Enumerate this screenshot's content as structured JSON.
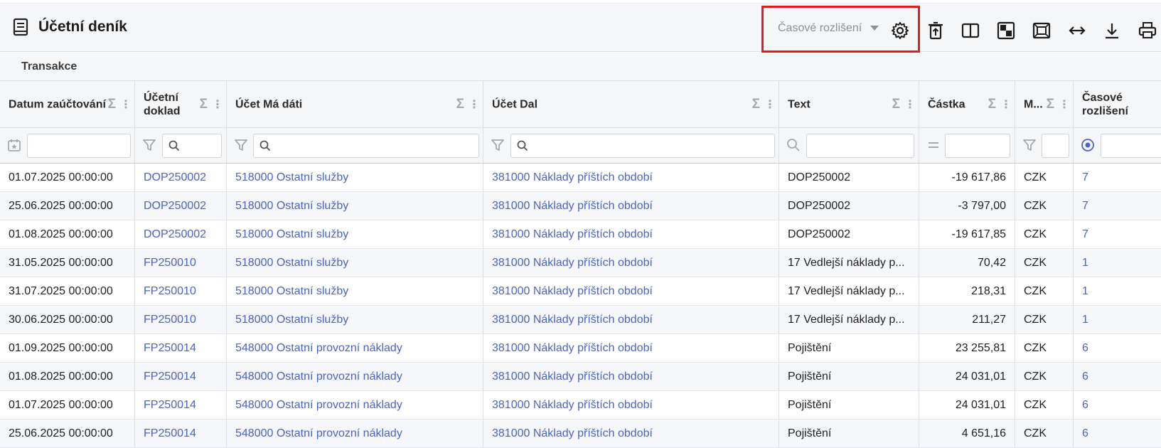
{
  "header": {
    "title": "Účetní deník",
    "dropdown_label": "Časové rozlišení"
  },
  "tabs": [
    {
      "label": "Transakce"
    }
  ],
  "columns": [
    {
      "key": "date",
      "label": "Datum zaúčtování",
      "filter_icon": "calendar-icon"
    },
    {
      "key": "doc",
      "label": "Účetní doklad",
      "filter_icon": "filter-icon"
    },
    {
      "key": "debit",
      "label": "Účet Má dáti",
      "filter_icon": "filter-icon"
    },
    {
      "key": "credit",
      "label": "Účet Dal",
      "filter_icon": "filter-icon"
    },
    {
      "key": "text",
      "label": "Text",
      "filter_icon": "search-icon"
    },
    {
      "key": "amount",
      "label": "Částka",
      "filter_icon": "equals-icon"
    },
    {
      "key": "cur",
      "label": "M...",
      "filter_icon": "filter-icon"
    },
    {
      "key": "accrual",
      "label": "Časové rozlišení",
      "filter_icon": "radio-icon"
    }
  ],
  "rows": [
    {
      "date": "01.07.2025 00:00:00",
      "doc": "DOP250002",
      "debit": "518000 Ostatní služby",
      "credit": "381000 Náklady příštích období",
      "text": "DOP250002",
      "amount": "-19 617,86",
      "cur": "CZK",
      "accrual": "7"
    },
    {
      "date": "25.06.2025 00:00:00",
      "doc": "DOP250002",
      "debit": "518000 Ostatní služby",
      "credit": "381000 Náklady příštích období",
      "text": "DOP250002",
      "amount": "-3 797,00",
      "cur": "CZK",
      "accrual": "7"
    },
    {
      "date": "01.08.2025 00:00:00",
      "doc": "DOP250002",
      "debit": "518000 Ostatní služby",
      "credit": "381000 Náklady příštích období",
      "text": "DOP250002",
      "amount": "-19 617,85",
      "cur": "CZK",
      "accrual": "7"
    },
    {
      "date": "31.05.2025 00:00:00",
      "doc": "FP250010",
      "debit": "518000 Ostatní služby",
      "credit": "381000 Náklady příštích období",
      "text": "17 Vedlejší náklady p...",
      "amount": "70,42",
      "cur": "CZK",
      "accrual": "1"
    },
    {
      "date": "31.07.2025 00:00:00",
      "doc": "FP250010",
      "debit": "518000 Ostatní služby",
      "credit": "381000 Náklady příštích období",
      "text": "17 Vedlejší náklady p...",
      "amount": "218,31",
      "cur": "CZK",
      "accrual": "1"
    },
    {
      "date": "30.06.2025 00:00:00",
      "doc": "FP250010",
      "debit": "518000 Ostatní služby",
      "credit": "381000 Náklady příštích období",
      "text": "17 Vedlejší náklady p...",
      "amount": "211,27",
      "cur": "CZK",
      "accrual": "1"
    },
    {
      "date": "01.09.2025 00:00:00",
      "doc": "FP250014",
      "debit": "548000 Ostatní provozní náklady",
      "credit": "381000 Náklady příštích období",
      "text": "Pojištění",
      "amount": "23 255,81",
      "cur": "CZK",
      "accrual": "6"
    },
    {
      "date": "01.08.2025 00:00:00",
      "doc": "FP250014",
      "debit": "548000 Ostatní provozní náklady",
      "credit": "381000 Náklady příštích období",
      "text": "Pojištění",
      "amount": "24 031,01",
      "cur": "CZK",
      "accrual": "6"
    },
    {
      "date": "01.07.2025 00:00:00",
      "doc": "FP250014",
      "debit": "548000 Ostatní provozní náklady",
      "credit": "381000 Náklady příštích období",
      "text": "Pojištění",
      "amount": "24 031,01",
      "cur": "CZK",
      "accrual": "6"
    },
    {
      "date": "25.06.2025 00:00:00",
      "doc": "FP250014",
      "debit": "548000 Ostatní provozní náklady",
      "credit": "381000 Náklady příštích období",
      "text": "Pojištění",
      "amount": "4 651,16",
      "cur": "CZK",
      "accrual": "6"
    }
  ],
  "colors": {
    "link": "#4a63c8",
    "highlight": "#e01e1e"
  }
}
